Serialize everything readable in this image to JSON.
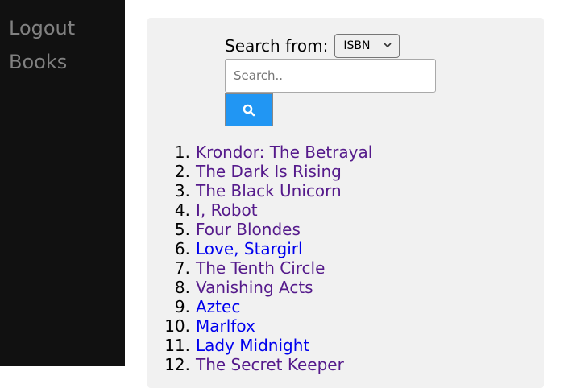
{
  "sidebar": {
    "items": [
      {
        "label": "Logout"
      },
      {
        "label": "Books"
      }
    ]
  },
  "search": {
    "label": "Search from:",
    "select_value": "ISBN",
    "placeholder": "Search..",
    "button_icon": "search-icon"
  },
  "colors": {
    "sidebar_bg": "#111111",
    "sidebar_text": "#818181",
    "panel_bg": "#f1f1f1",
    "button_bg": "#2196f3",
    "link_visited": "#551a8b",
    "link_unvisited": "#0000ee"
  },
  "books": [
    {
      "num": "1.",
      "title": "Krondor: The Betrayal",
      "visited": true
    },
    {
      "num": "2.",
      "title": "The Dark Is Rising",
      "visited": true
    },
    {
      "num": "3.",
      "title": "The Black Unicorn",
      "visited": true
    },
    {
      "num": "4.",
      "title": "I, Robot",
      "visited": true
    },
    {
      "num": "5.",
      "title": "Four Blondes",
      "visited": true
    },
    {
      "num": "6.",
      "title": "Love, Stargirl",
      "visited": false
    },
    {
      "num": "7.",
      "title": "The Tenth Circle",
      "visited": true
    },
    {
      "num": "8.",
      "title": "Vanishing Acts",
      "visited": true
    },
    {
      "num": "9.",
      "title": "Aztec",
      "visited": false
    },
    {
      "num": "10.",
      "title": "Marlfox",
      "visited": false
    },
    {
      "num": "11.",
      "title": "Lady Midnight",
      "visited": false
    },
    {
      "num": "12.",
      "title": "The Secret Keeper",
      "visited": true
    }
  ]
}
